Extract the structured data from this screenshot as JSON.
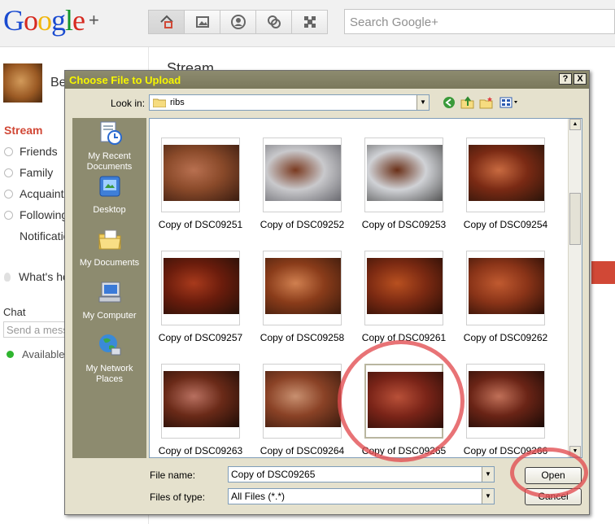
{
  "google_plus": {
    "logo": {
      "letters": [
        {
          "ch": "G",
          "cls": "b"
        },
        {
          "ch": "o",
          "cls": "r"
        },
        {
          "ch": "o",
          "cls": "y"
        },
        {
          "ch": "g",
          "cls": "b"
        },
        {
          "ch": "l",
          "cls": "g"
        },
        {
          "ch": "e",
          "cls": "r"
        }
      ],
      "plus": "+"
    },
    "nav_icons": [
      "home-icon",
      "photos-icon",
      "profile-icon",
      "circles-icon",
      "games-icon"
    ],
    "search_placeholder": "Search Google+",
    "profile_name": "Be",
    "stream_title": "Stream",
    "sidebar": {
      "stream": "Stream",
      "items": [
        "Friends",
        "Family",
        "Acquainta",
        "Following"
      ],
      "notifications": "Notificatio",
      "whats_hot": "What's ho"
    },
    "chat": {
      "label": "Chat",
      "input_placeholder": "Send a mess",
      "status": "Available"
    }
  },
  "dialog": {
    "title": "Choose File to Upload",
    "help_button": "?",
    "close_button": "X",
    "look_in_label": "Look in:",
    "look_in_value": "ribs",
    "toolbar_icons": [
      "back-icon",
      "up-folder-icon",
      "new-folder-icon",
      "view-menu-icon"
    ],
    "places": [
      {
        "label": "My Recent Documents",
        "icon": "recent-documents-icon"
      },
      {
        "label": "Desktop",
        "icon": "desktop-icon"
      },
      {
        "label": "My Documents",
        "icon": "my-documents-icon"
      },
      {
        "label": "My Computer",
        "icon": "my-computer-icon"
      },
      {
        "label": "My Network Places",
        "icon": "network-places-icon"
      }
    ],
    "files": [
      "Copy of DSC09251",
      "Copy of DSC09252",
      "Copy of DSC09253",
      "Copy of DSC09254",
      "Copy of DSC09257",
      "Copy of DSC09258",
      "Copy of DSC09261",
      "Copy of DSC09262",
      "Copy of DSC09263",
      "Copy of DSC09264",
      "Copy of DSC09265",
      "Copy of DSC09266"
    ],
    "selected_file": "Copy of DSC09265",
    "file_name_label": "File name:",
    "file_name_value": "Copy of DSC09265",
    "files_of_type_label": "Files of type:",
    "files_of_type_value": "All Files (*.*)",
    "open_button": "Open",
    "cancel_button": "Cancel"
  },
  "colors": {
    "title_text": "#f6f600",
    "highlight_circle": "#e24b50",
    "places_bar": "#8d8b6f"
  }
}
